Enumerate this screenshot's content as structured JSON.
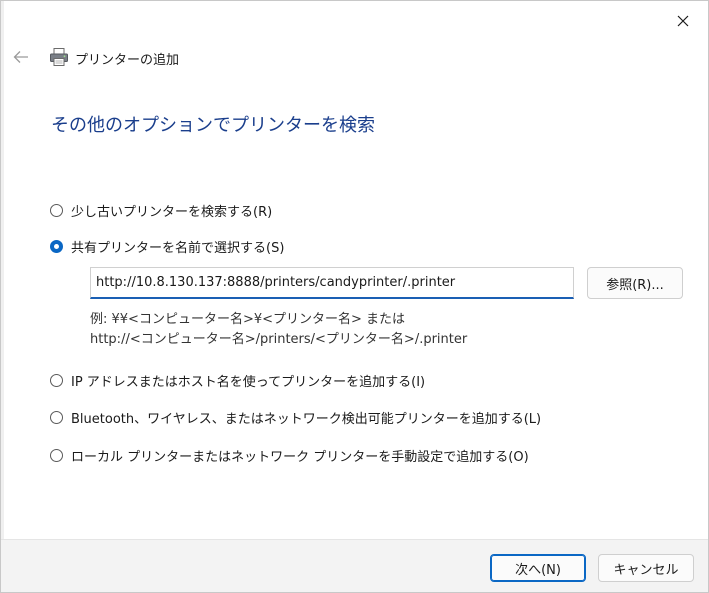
{
  "window": {
    "title": "プリンターの追加",
    "icons": {
      "back": "back-arrow-icon",
      "close": "close-icon",
      "title": "printer-icon"
    }
  },
  "heading": "その他のオプションでプリンターを検索",
  "options": [
    {
      "label": "少し古いプリンターを検索する(R)",
      "checked": false
    },
    {
      "label": "共有プリンターを名前で選択する(S)",
      "checked": true
    },
    {
      "label": "IP アドレスまたはホスト名を使ってプリンターを追加する(I)",
      "checked": false
    },
    {
      "label": "Bluetooth、ワイヤレス、またはネットワーク検出可能プリンターを追加する(L)",
      "checked": false
    },
    {
      "label": "ローカル プリンターまたはネットワーク プリンターを手動設定で追加する(O)",
      "checked": false
    }
  ],
  "shared_printer": {
    "value": "http://10.8.130.137:8888/printers/candyprinter/.printer",
    "browse_label": "参照(R)...",
    "example_line1": "例: ¥¥<コンピューター名>¥<プリンター名> または",
    "example_line2": "http://<コンピューター名>/printers/<プリンター名>/.printer"
  },
  "footer": {
    "next_label": "次へ(N)",
    "cancel_label": "キャンセル"
  },
  "colors": {
    "accent": "#0a67c4",
    "heading": "#1a3e8c"
  }
}
